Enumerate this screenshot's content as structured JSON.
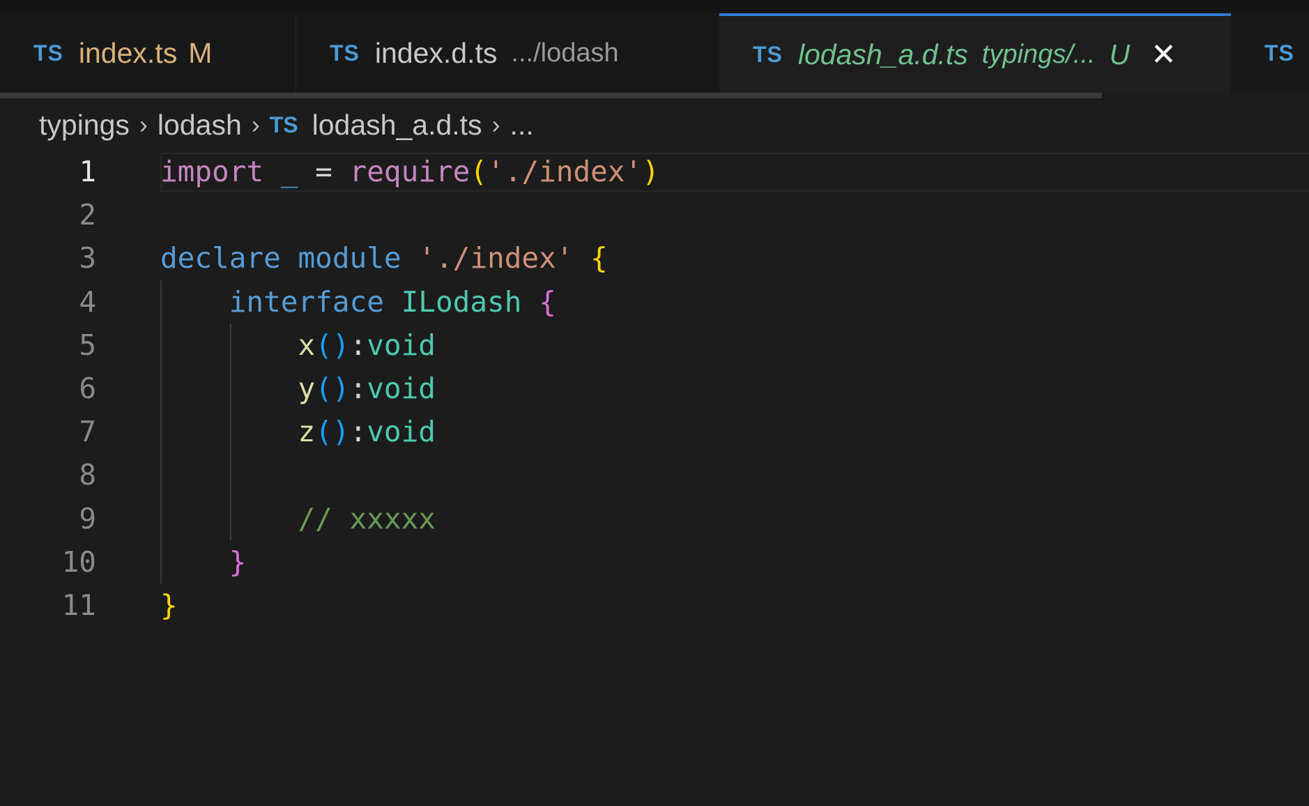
{
  "tabs": [
    {
      "icon": "TS",
      "name": "index.ts",
      "badge": "M"
    },
    {
      "icon": "TS",
      "name": "index.d.ts",
      "path": ".../lodash"
    },
    {
      "icon": "TS",
      "name": "lodash_a.d.ts",
      "path": "typings/...",
      "badge": "U",
      "close": "✕",
      "active": true
    },
    {
      "icon": "TS"
    }
  ],
  "breadcrumb": {
    "items": [
      "typings",
      "lodash",
      "lodash_a.d.ts",
      "..."
    ],
    "icon": "TS",
    "sep": "›"
  },
  "editor": {
    "line_numbers": [
      "1",
      "2",
      "3",
      "4",
      "5",
      "6",
      "7",
      "8",
      "9",
      "10",
      "11"
    ],
    "code": {
      "l1": {
        "import": "import",
        "underscore": "_",
        "eq": " = ",
        "require": "require",
        "open": "(",
        "str": "'./index'",
        "close": ")"
      },
      "l3": {
        "declare": "declare",
        "module": " module",
        "str": "'./index'",
        "brace": "{"
      },
      "l4": {
        "interface": "interface",
        "name": "ILodash",
        "brace": "{"
      },
      "l5": {
        "id": "x",
        "parens": "()",
        "colon": ":",
        "type": "void"
      },
      "l6": {
        "id": "y",
        "parens": "()",
        "colon": ":",
        "type": "void"
      },
      "l7": {
        "id": "z",
        "parens": "()",
        "colon": ":",
        "type": "void"
      },
      "l9": {
        "comment": "// xxxxx"
      },
      "l10": {
        "brace": "}"
      },
      "l11": {
        "brace": "}"
      }
    }
  }
}
